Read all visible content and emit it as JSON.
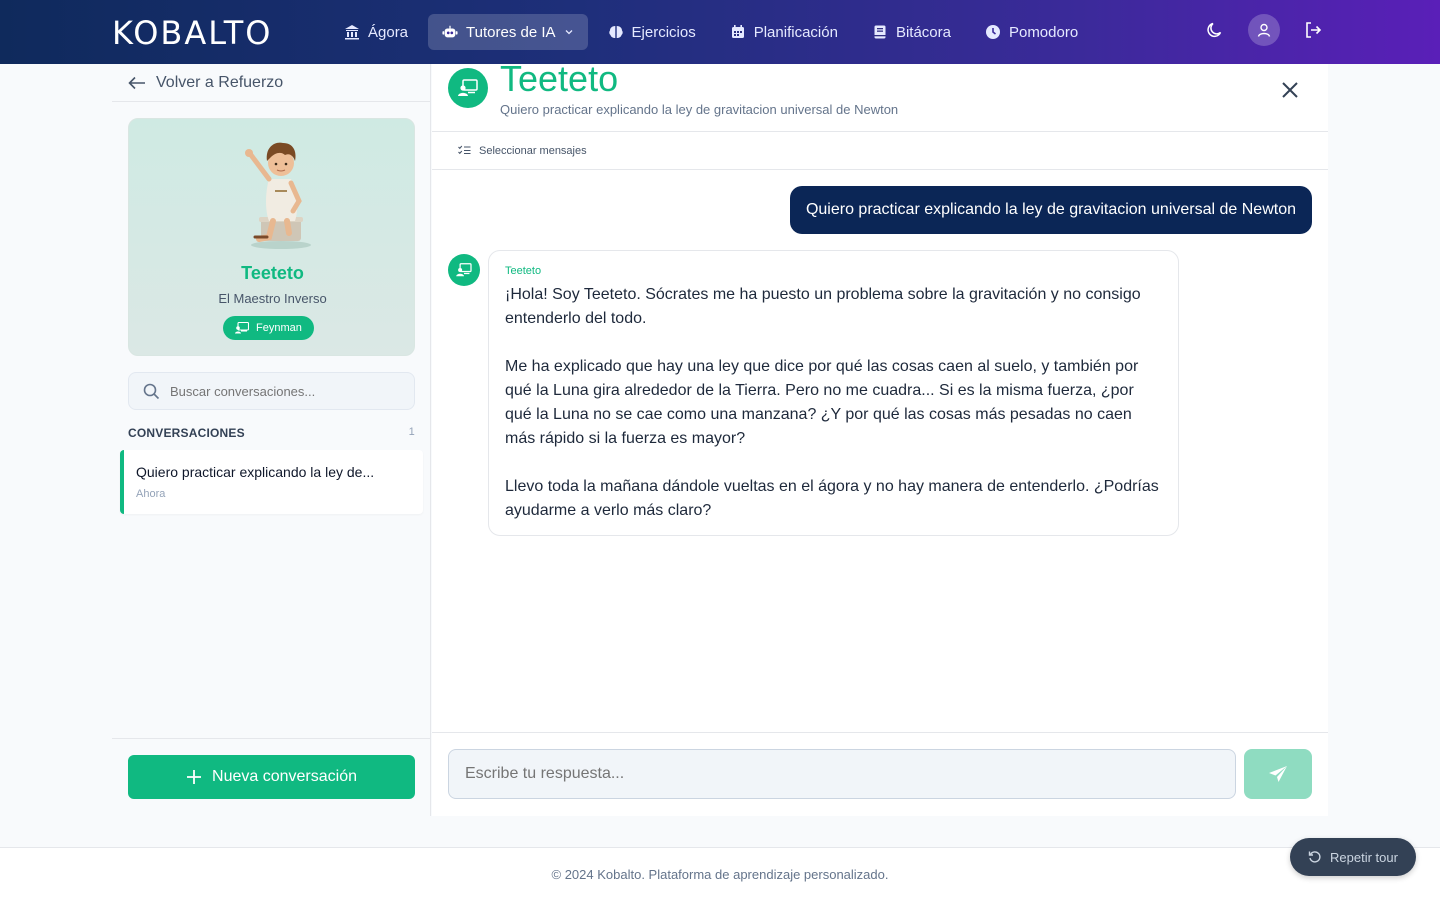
{
  "app": {
    "logo": "KOBALTO"
  },
  "nav": {
    "items": [
      {
        "label": "Ágora",
        "icon": "bank-icon"
      },
      {
        "label": "Tutores de IA",
        "icon": "robot-icon",
        "active": true
      },
      {
        "label": "Ejercicios",
        "icon": "brain-icon"
      },
      {
        "label": "Planificación",
        "icon": "calendar-icon"
      },
      {
        "label": "Bitácora",
        "icon": "book-icon"
      },
      {
        "label": "Pomodoro",
        "icon": "clock-icon"
      }
    ],
    "right_icons": [
      "moon-icon",
      "user-icon",
      "logout-icon"
    ]
  },
  "sidebar": {
    "back_label": "Volver a Refuerzo",
    "tutor": {
      "name": "Teeteto",
      "role": "El Maestro Inverso",
      "badge": "Feynman"
    },
    "search_placeholder": "Buscar conversaciones...",
    "conversations_header": "CONVERSACIONES",
    "conversations_count": "1",
    "conversations": [
      {
        "title": "Quiero practicar explicando la ley de...",
        "time": "Ahora"
      }
    ],
    "new_conversation_label": "Nueva conversación"
  },
  "chat": {
    "title": "Teeteto",
    "subtitle": "Quiero practicar explicando la ley de gravitacion universal de Newton",
    "select_messages_label": "Seleccionar mensajes",
    "user_message": "Quiero practicar explicando la ley de gravitacion universal de Newton",
    "bot_name": "Teeteto",
    "bot_message": "¡Hola! Soy Teeteto. Sócrates me ha puesto un problema sobre la gravitación y no consigo entenderlo del todo.\n\nMe ha explicado que hay una ley que dice por qué las cosas caen al suelo, y también por qué la Luna gira alrededor de la Tierra. Pero no me cuadra... Si es la misma fuerza, ¿por qué la Luna no se cae como una manzana? ¿Y por qué las cosas más pesadas no caen más rápido si la fuerza es mayor?\n\nLlevo toda la mañana dándole vueltas en el ágora y no hay manera de entenderlo. ¿Podrías ayudarme a verlo más claro?",
    "reply_placeholder": "Escribe tu respuesta..."
  },
  "footer": {
    "text": "© 2024 Kobalto. Plataforma de aprendizaje personalizado."
  },
  "tour_button_label": "Repetir tour",
  "colors": {
    "accent": "#10b981",
    "user_bubble": "#0b2656",
    "nav_start": "#0f2a5c",
    "nav_end": "#5a1fb8"
  }
}
